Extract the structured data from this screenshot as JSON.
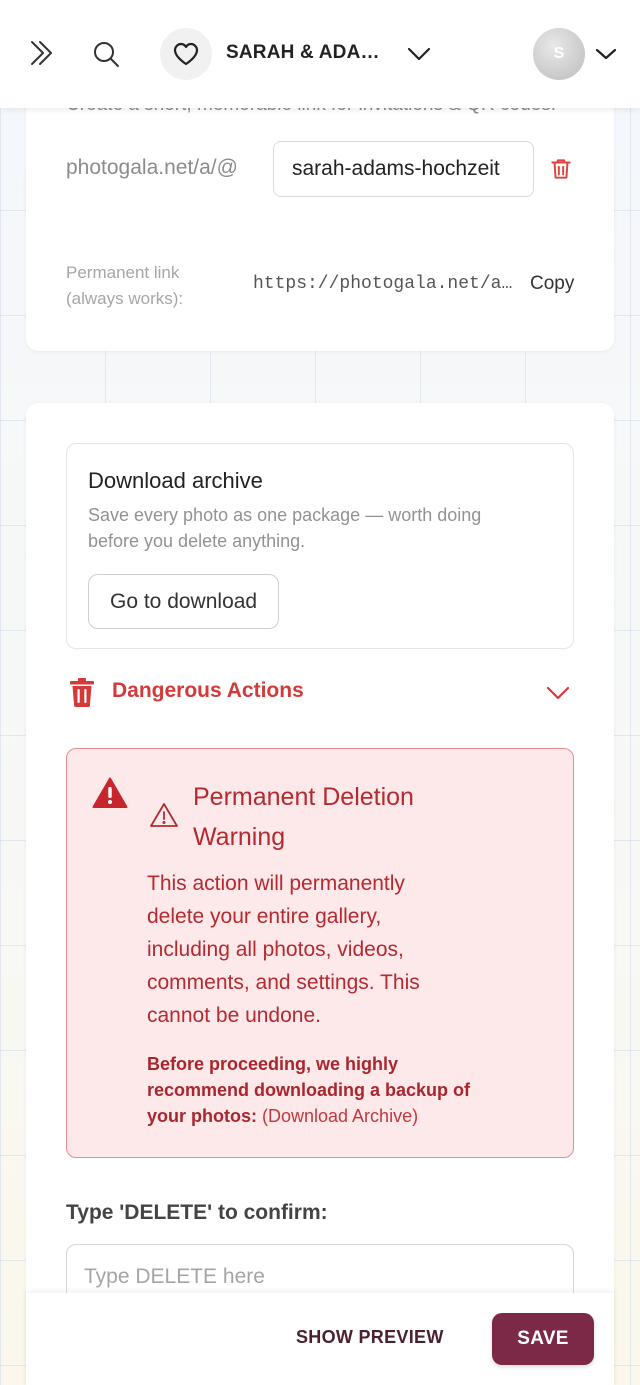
{
  "header": {
    "gallery_title": "SARAH & ADAM'...",
    "avatar_initial": "S"
  },
  "link_section": {
    "description": "Create a short, memorable link for invitations & QR codes.",
    "prefix": "photogala.net/a/@",
    "slug_value": "sarah-adams-hochzeit",
    "permanent_label": "Permanent link (always works):",
    "permanent_url": "https://photogala.net/a...",
    "copy_label": "Copy"
  },
  "archive": {
    "title": "Download archive",
    "description": "Save every photo as one package — worth doing before you delete anything.",
    "button_label": "Go to download"
  },
  "danger": {
    "section_label": "Dangerous Actions",
    "warning_title": "Permanent Deletion Warning",
    "warning_text": "This action will permanently delete your entire gallery, including all photos, videos, comments, and settings. This cannot be undone.",
    "note_text": "Before proceeding, we highly recommend downloading a backup of your photos: ",
    "note_link": "(Download Archive)",
    "confirm_label": "Type 'DELETE' to confirm:",
    "confirm_placeholder": "Type DELETE here"
  },
  "footer": {
    "preview_label": "SHOW PREVIEW",
    "save_label": "SAVE"
  },
  "colors": {
    "accent": "#7c2948",
    "danger": "#d33a3a",
    "warning_bg": "#fde8ea"
  }
}
